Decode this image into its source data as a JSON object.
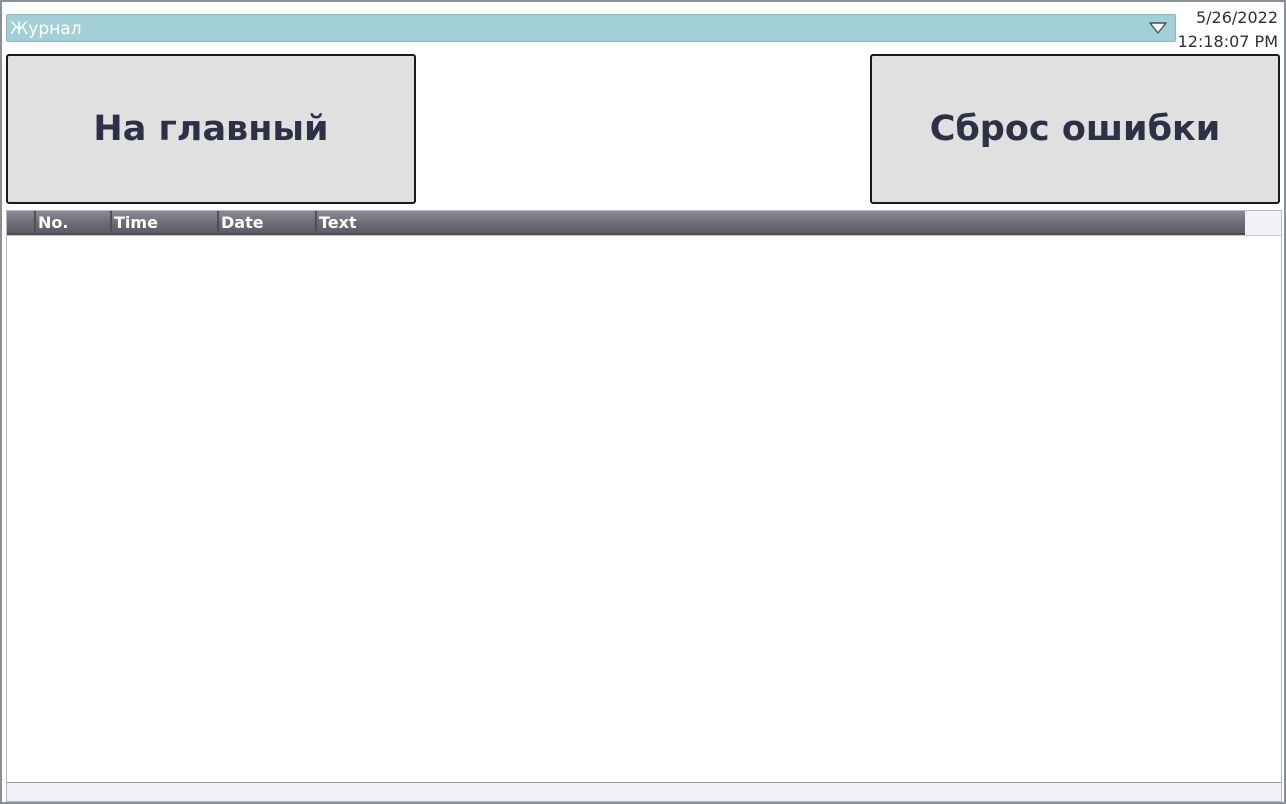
{
  "screen_selector": {
    "value": "Журнал"
  },
  "clock": {
    "date": "5/26/2022",
    "time": "12:18:07 PM"
  },
  "buttons": {
    "home_label": "На главный",
    "reset_label": "Сброс ошибки"
  },
  "alarm_table": {
    "columns": [
      "",
      "No.",
      "Time",
      "Date",
      "Text"
    ],
    "rows": []
  },
  "colors": {
    "dropdown_bg": "#a3cfd6",
    "button_bg": "#e0e0e0",
    "button_text": "#2e3045",
    "header_bg": "#6a6a74"
  }
}
